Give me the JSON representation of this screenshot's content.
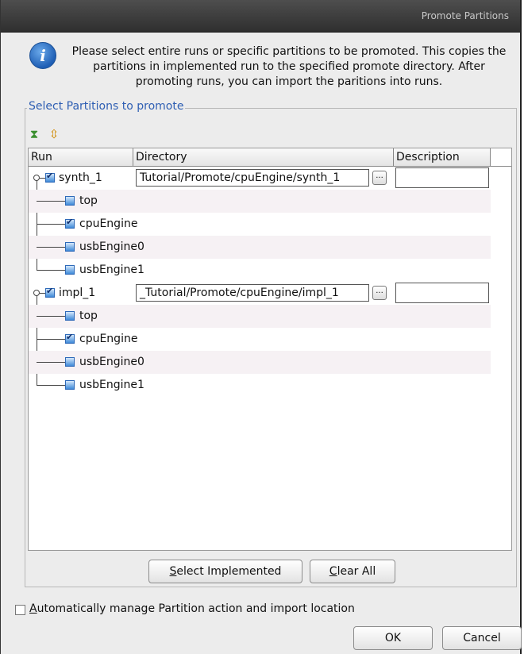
{
  "dialog": {
    "title": "Promote Partitions",
    "info_text": "Please select entire runs or specific partitions to be promoted. This copies the partitions in implemented run to the specified promote directory. After promoting runs, you can import the paritions into runs.",
    "group_title": "Select Partitions to promote",
    "toolbar": {
      "expand_icon": "expand-all-icon",
      "collapse_icon": "collapse-all-icon"
    },
    "columns": [
      "Run",
      "Directory",
      "Description"
    ],
    "runs": [
      {
        "name": "synth_1",
        "checked": true,
        "directory": "Tutorial/Promote/cpuEngine/synth_1",
        "browse": "...",
        "description": "",
        "partitions": [
          {
            "name": "top",
            "checked": false
          },
          {
            "name": "cpuEngine",
            "checked": true
          },
          {
            "name": "usbEngine0",
            "checked": false
          },
          {
            "name": "usbEngine1",
            "checked": false
          }
        ]
      },
      {
        "name": "impl_1",
        "checked": true,
        "directory": "_Tutorial/Promote/cpuEngine/impl_1",
        "browse": "...",
        "description": "",
        "partitions": [
          {
            "name": "top",
            "checked": false
          },
          {
            "name": "cpuEngine",
            "checked": true
          },
          {
            "name": "usbEngine0",
            "checked": false
          },
          {
            "name": "usbEngine1",
            "checked": false
          }
        ]
      }
    ],
    "select_implemented": {
      "mnemonic": "S",
      "rest": "elect Implemented"
    },
    "clear_all": {
      "mnemonic": "C",
      "rest": "lear All"
    },
    "auto_manage": {
      "mnemonic": "A",
      "rest": "utomatically manage Partition action and import location",
      "checked": false
    },
    "ok_label": "OK",
    "cancel_label": "Cancel"
  }
}
